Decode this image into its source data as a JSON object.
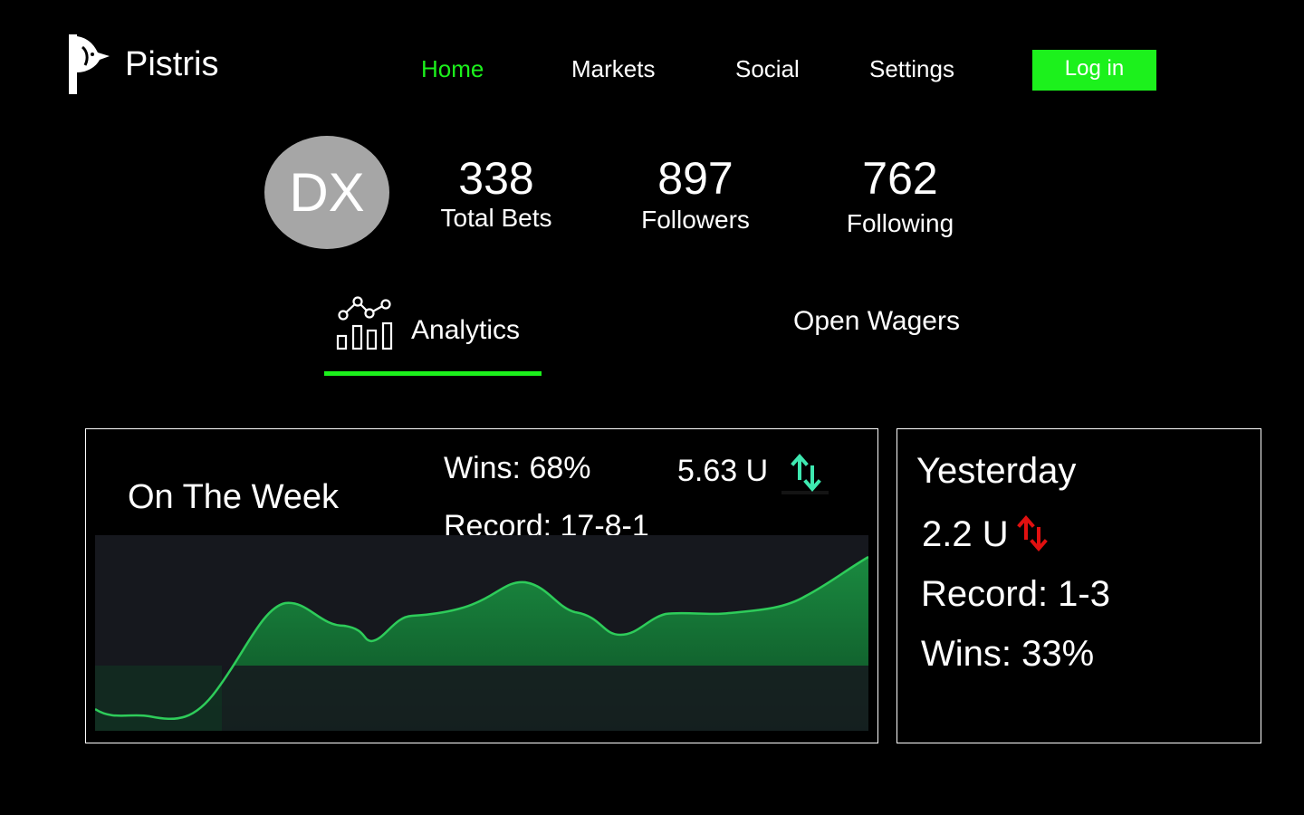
{
  "app": {
    "brand": "Pistris"
  },
  "nav": {
    "items": [
      {
        "label": "Home",
        "active": true
      },
      {
        "label": "Markets",
        "active": false
      },
      {
        "label": "Social",
        "active": false
      },
      {
        "label": "Settings",
        "active": false
      }
    ],
    "login_label": "Log in"
  },
  "profile": {
    "initials": "DX",
    "stats": [
      {
        "value": "338",
        "label": "Total Bets"
      },
      {
        "value": "897",
        "label": "Followers"
      },
      {
        "value": "762",
        "label": "Following"
      }
    ]
  },
  "tabs": [
    {
      "label": "Analytics",
      "icon": "analytics-chart-icon",
      "active": true
    },
    {
      "label": "Open Wagers",
      "active": false
    }
  ],
  "week": {
    "title": "On The Week",
    "wins": "Wins: 68%",
    "units": "5.63 U",
    "trend_icon": "up-down-arrows-icon",
    "record": "Record: 17-8-1"
  },
  "yesterday": {
    "title": "Yesterday",
    "units": "2.2 U",
    "trend_icon": "up-down-arrows-icon",
    "record": "Record: 1-3",
    "wins": "Wins: 33%"
  },
  "colors": {
    "accent": "#1cf11c",
    "background": "#000000",
    "chart_bg": "#16181e",
    "chart_line": "#2ecc5a",
    "chart_fill_top": "#1a8a40",
    "trend_up_teal": "#3ee8b0",
    "trend_red": "#e01010"
  }
}
